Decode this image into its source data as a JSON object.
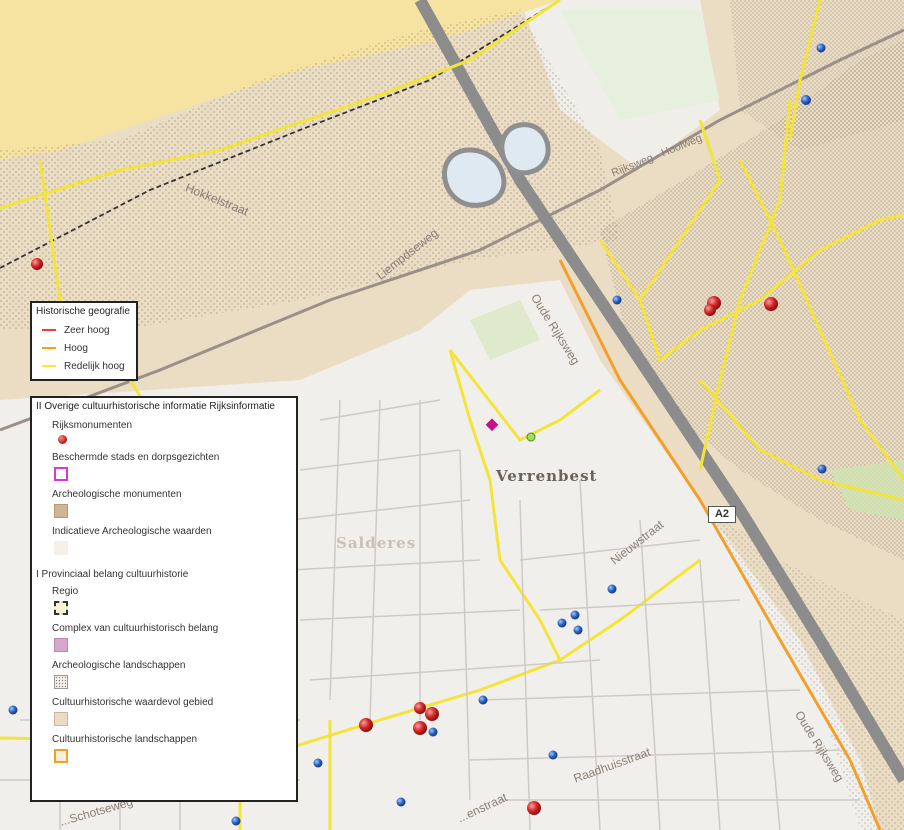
{
  "map_labels": {
    "hokkelstraat": "Hokkelstraat",
    "liempdseweg": "Liempdseweg",
    "ringweg": "Rijksweg - Hoolweg",
    "oudenrijksweg_n": "Oude Rijksweg",
    "nieuwstraat": "Nieuwstraat",
    "oude_rijksweg_s": "Oude Rijksweg",
    "raadhuisstraat": "Raadhuisstraat",
    "kerkstraat": "...enstraat",
    "schotsweg": "...Schotseweg",
    "a2": "A2",
    "verrenbest": "Verrenbest",
    "salderes": "Salderes"
  },
  "legend1": {
    "title": "Historische geografie",
    "items": [
      {
        "label": "Zeer hoog",
        "color": "#e8403a"
      },
      {
        "label": "Hoog",
        "color": "#f5a21b"
      },
      {
        "label": "Redelijk hoog",
        "color": "#f7e83a"
      }
    ]
  },
  "legend2": {
    "title": "II Overige cultuurhistorische informatie Rijksinformatie",
    "items1": [
      {
        "label": "Rijksmonumenten",
        "icon": "red-dot-icon"
      },
      {
        "label": "Beschermde stads en dorpsgezichten",
        "icon": "magenta-outline-square-icon"
      },
      {
        "label": "Archeologische monumenten",
        "icon": "tan-dotted-square-icon"
      },
      {
        "label": "Indicatieve Archeologische waarden",
        "icon": "light-square-icon"
      }
    ],
    "subtitle": "I Provinciaal belang cultuurhistorie",
    "items2": [
      {
        "label": "Regio",
        "icon": "dashed-square-icon"
      },
      {
        "label": "Complex van cultuurhistorisch belang",
        "icon": "pink-square-icon"
      },
      {
        "label": "Archeologische landschappen",
        "icon": "dotted-square-icon"
      },
      {
        "label": "Cultuurhistorische waardevol gebied",
        "icon": "beige-square-icon"
      },
      {
        "label": "Cultuurhistorische landschappen",
        "icon": "orange-outline-square-icon"
      }
    ]
  },
  "colors": {
    "regio_fill": "#f6e3a1",
    "landscape_fill": "#ebdcc4",
    "built_area": "#efece8",
    "highway": "#8c8c8c",
    "road_yellow": "#f3e43a",
    "road_orange": "#f1a02a"
  }
}
